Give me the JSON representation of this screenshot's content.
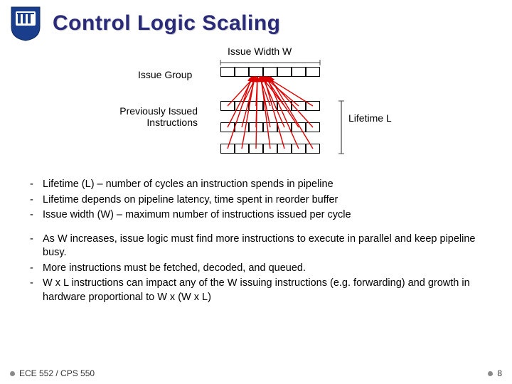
{
  "title": "Control Logic Scaling",
  "diagram": {
    "issue_width_label": "Issue Width W",
    "issue_group_label": "Issue Group",
    "prev_issued_label_line1": "Previously Issued",
    "prev_issued_label_line2": "Instructions",
    "lifetime_label": "Lifetime L",
    "rows": 4,
    "cols": 7,
    "row_gap": 16,
    "deps_from_first_row_to_below": true
  },
  "bullets_group1": [
    "Lifetime (L) – number of cycles an instruction spends in pipeline",
    "Lifetime depends on pipeline latency, time spent in reorder buffer",
    "Issue width (W) – maximum number of instructions issued per cycle"
  ],
  "bullets_group2": [
    "As W increases, issue logic must find more instructions to execute in parallel and keep pipeline busy.",
    "More instructions must be fetched, decoded, and queued.",
    "W x L instructions can impact any of the W issuing instructions (e.g. forwarding) and growth in hardware proportional to W x (W x L)"
  ],
  "footer": {
    "course": "ECE 552 / CPS 550",
    "page": "8"
  },
  "logo": {
    "desc": "shield-with-columns",
    "primary": "#1a3e8c",
    "accent": "#fff"
  }
}
